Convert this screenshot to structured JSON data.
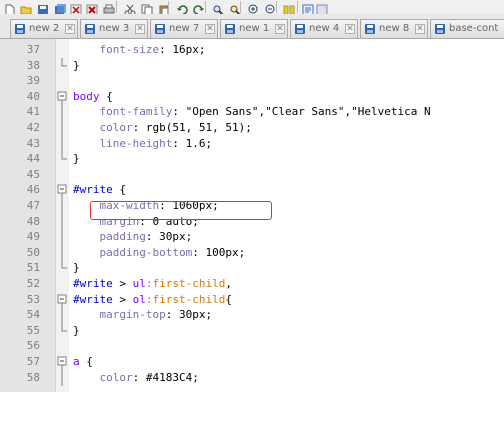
{
  "toolbar": {
    "icons": [
      "new-file-icon",
      "open-folder-icon",
      "save-icon",
      "save-all-icon",
      "close-icon",
      "close-all-icon",
      "print-icon",
      "cut-icon",
      "copy-icon",
      "paste-icon",
      "undo-icon",
      "redo-icon",
      "find-icon",
      "replace-icon",
      "zoom-in-icon",
      "zoom-out-icon",
      "sync-icon",
      "wrap-icon",
      "show-all-icon"
    ]
  },
  "tabs": [
    {
      "label": "new 2"
    },
    {
      "label": "new 3"
    },
    {
      "label": "new 7"
    },
    {
      "label": "new 1"
    },
    {
      "label": "new 4"
    },
    {
      "label": "new 8"
    },
    {
      "label": "base-cont"
    }
  ],
  "tab_close_glyph": "✕",
  "editor": {
    "lines": [
      {
        "n": "37",
        "fold": "",
        "tokens": [
          {
            "t": "    ",
            "c": ""
          },
          {
            "t": "font-size",
            "c": "prop"
          },
          {
            "t": ": 16px;",
            "c": "val"
          }
        ]
      },
      {
        "n": "38",
        "fold": "end",
        "tokens": [
          {
            "t": "}",
            "c": "brace"
          }
        ]
      },
      {
        "n": "39",
        "fold": "",
        "tokens": []
      },
      {
        "n": "40",
        "fold": "start",
        "tokens": [
          {
            "t": "body",
            "c": "sel"
          },
          {
            "t": " {",
            "c": "brace"
          }
        ]
      },
      {
        "n": "41",
        "fold": "",
        "tokens": [
          {
            "t": "    ",
            "c": ""
          },
          {
            "t": "font-family",
            "c": "prop"
          },
          {
            "t": ": \"Open Sans\",\"Clear Sans\",\"Helvetica N",
            "c": "val"
          }
        ]
      },
      {
        "n": "42",
        "fold": "",
        "tokens": [
          {
            "t": "    ",
            "c": ""
          },
          {
            "t": "color",
            "c": "prop"
          },
          {
            "t": ": rgb(51, 51, 51);",
            "c": "val"
          }
        ]
      },
      {
        "n": "43",
        "fold": "",
        "tokens": [
          {
            "t": "    ",
            "c": ""
          },
          {
            "t": "line-height",
            "c": "prop"
          },
          {
            "t": ": 1.6;",
            "c": "val"
          }
        ]
      },
      {
        "n": "44",
        "fold": "end",
        "tokens": [
          {
            "t": "}",
            "c": "brace"
          }
        ]
      },
      {
        "n": "45",
        "fold": "",
        "tokens": []
      },
      {
        "n": "46",
        "fold": "start",
        "tokens": [
          {
            "t": "#write",
            "c": "id"
          },
          {
            "t": " {",
            "c": "brace"
          }
        ]
      },
      {
        "n": "47",
        "fold": "",
        "tokens": [
          {
            "t": "    ",
            "c": ""
          },
          {
            "t": "max-width",
            "c": "prop"
          },
          {
            "t": ": 1060px;",
            "c": "val"
          }
        ]
      },
      {
        "n": "48",
        "fold": "",
        "tokens": [
          {
            "t": "    ",
            "c": ""
          },
          {
            "t": "margin",
            "c": "prop"
          },
          {
            "t": ": 0 auto;",
            "c": "val"
          }
        ]
      },
      {
        "n": "49",
        "fold": "",
        "tokens": [
          {
            "t": "    ",
            "c": ""
          },
          {
            "t": "padding",
            "c": "prop"
          },
          {
            "t": ": 30px;",
            "c": "val"
          }
        ]
      },
      {
        "n": "50",
        "fold": "",
        "tokens": [
          {
            "t": "    ",
            "c": ""
          },
          {
            "t": "padding-bottom",
            "c": "prop"
          },
          {
            "t": ": 100px;",
            "c": "val"
          }
        ]
      },
      {
        "n": "51",
        "fold": "end",
        "tokens": [
          {
            "t": "}",
            "c": "brace"
          }
        ]
      },
      {
        "n": "52",
        "fold": "",
        "tokens": [
          {
            "t": "#write",
            "c": "id"
          },
          {
            "t": " > ",
            "c": "val"
          },
          {
            "t": "ul",
            "c": "sel"
          },
          {
            "t": ":first-child",
            "c": "pseudo"
          },
          {
            "t": ",",
            "c": "val"
          }
        ]
      },
      {
        "n": "53",
        "fold": "start",
        "tokens": [
          {
            "t": "#write",
            "c": "id"
          },
          {
            "t": " > ",
            "c": "val"
          },
          {
            "t": "ol",
            "c": "sel"
          },
          {
            "t": ":first-child",
            "c": "pseudo"
          },
          {
            "t": "{",
            "c": "brace"
          }
        ]
      },
      {
        "n": "54",
        "fold": "",
        "tokens": [
          {
            "t": "    ",
            "c": ""
          },
          {
            "t": "margin-top",
            "c": "prop"
          },
          {
            "t": ": 30px;",
            "c": "val"
          }
        ]
      },
      {
        "n": "55",
        "fold": "end",
        "tokens": [
          {
            "t": "}",
            "c": "brace"
          }
        ]
      },
      {
        "n": "56",
        "fold": "",
        "tokens": []
      },
      {
        "n": "57",
        "fold": "start",
        "tokens": [
          {
            "t": "a",
            "c": "sel"
          },
          {
            "t": " {",
            "c": "brace"
          }
        ]
      },
      {
        "n": "58",
        "fold": "",
        "tokens": [
          {
            "t": "    ",
            "c": ""
          },
          {
            "t": "color",
            "c": "prop"
          },
          {
            "t": ": #4183C4;",
            "c": "val"
          }
        ]
      }
    ]
  },
  "highlighted_line": "47",
  "colors": {
    "selector": "#8000ff",
    "id_selector": "#0000cc",
    "property": "#7f6aad",
    "pseudo": "#d87900",
    "highlight_box": "#e0332f",
    "gutter": "#e4e4e4"
  }
}
